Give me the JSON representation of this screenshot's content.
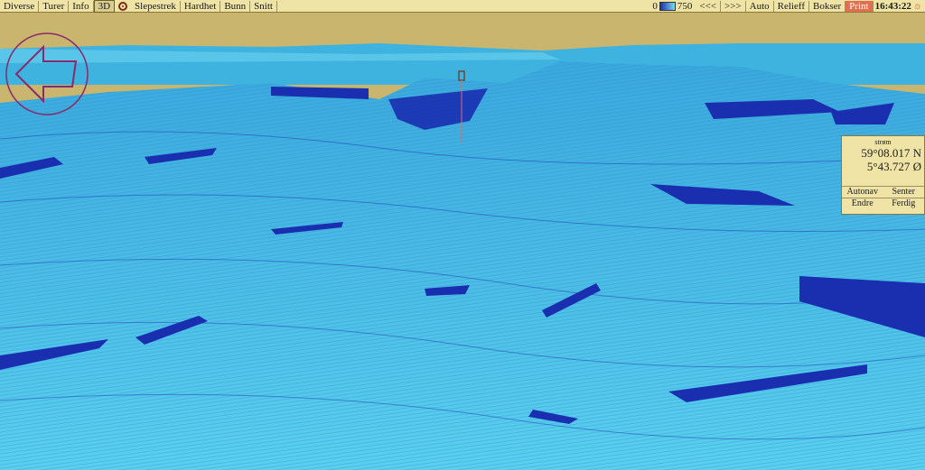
{
  "toolbar": {
    "left_buttons": [
      "Diverse",
      "Turer",
      "Info",
      "3D"
    ],
    "right_buttons_after_target": [
      "Slepestrek",
      "Hardhet",
      "Bunn",
      "Snitt"
    ],
    "scale_min": "0",
    "scale_max": "750",
    "nav_buttons": [
      "<<<",
      ">>>",
      "Auto",
      "Relieff",
      "Bokser",
      "Print"
    ],
    "clock": "16:43:22"
  },
  "panel": {
    "mode": "strøm",
    "lat": "59°08.017 N",
    "lon": "5°43.727 Ø",
    "row1": [
      "Autonav",
      "Senter"
    ],
    "row2": [
      "Endre",
      "Ferdig"
    ]
  },
  "colors": {
    "sky": "#c9b56e",
    "toolbar": "#efe3a6",
    "seabed": "#4cc2e6",
    "ridge": "#1a2fb0"
  },
  "icons": [
    "target-icon",
    "scale-gradient-icon",
    "sun-icon",
    "back-arrow-icon"
  ]
}
